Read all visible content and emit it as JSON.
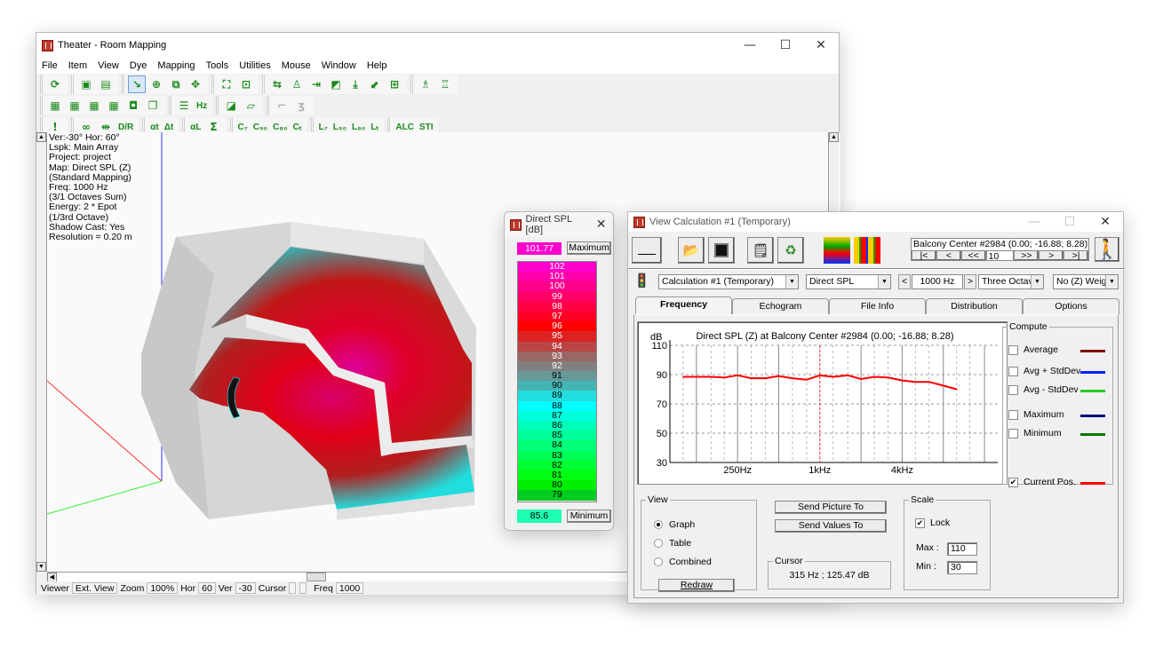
{
  "main_window": {
    "title": "Theater - Room Mapping",
    "controls": {
      "minimize": "—",
      "maximize": "☐",
      "close": "✕"
    },
    "menu": [
      "File",
      "Item",
      "View",
      "Dye",
      "Mapping",
      "Tools",
      "Utilities",
      "Mouse",
      "Window",
      "Help"
    ],
    "toolbar_row1": [
      {
        "icon": "refresh-icon",
        "glyph": "⟳"
      },
      {
        "icon": "view-export-icon",
        "glyph": "▣"
      },
      {
        "icon": "view-import-icon",
        "glyph": "▤"
      },
      {
        "icon": "pointer-tool-icon",
        "glyph": "↘"
      },
      {
        "icon": "target-icon",
        "glyph": "⊕"
      },
      {
        "icon": "zoom-window-icon",
        "glyph": "⧉"
      },
      {
        "icon": "pan-icon",
        "glyph": "✥"
      },
      {
        "icon": "zoom-extents-icon",
        "glyph": "⛶"
      },
      {
        "icon": "fit-all-icon",
        "glyph": "⊡"
      },
      {
        "icon": "rotate-object-icon",
        "glyph": "⇆"
      },
      {
        "icon": "listener-icon",
        "glyph": "♙"
      },
      {
        "icon": "move-to-icon",
        "glyph": "⇥"
      },
      {
        "icon": "select-area-icon",
        "glyph": "◩"
      },
      {
        "icon": "download-icon",
        "glyph": "⤓"
      },
      {
        "icon": "arrow-diagonal-icon",
        "glyph": "⬋"
      },
      {
        "icon": "frame-icon",
        "glyph": "⊞"
      },
      {
        "icon": "loudspeaker-add-icon",
        "glyph": "♗"
      },
      {
        "icon": "loudspeaker-remove-icon",
        "glyph": "♖"
      }
    ],
    "toolbar_row2": [
      {
        "icon": "layout-1-icon",
        "glyph": "▦"
      },
      {
        "icon": "layout-2-icon",
        "glyph": "▦"
      },
      {
        "icon": "layout-3-icon",
        "glyph": "▦"
      },
      {
        "icon": "layout-4-icon",
        "glyph": "▦"
      },
      {
        "icon": "layout-5-icon",
        "glyph": "◘"
      },
      {
        "icon": "layers-icon",
        "glyph": "❐"
      },
      {
        "icon": "list-icon",
        "glyph": "☰"
      },
      {
        "icon": "hz-icon",
        "glyph": "Hz"
      },
      {
        "icon": "face-icon",
        "glyph": "◪"
      },
      {
        "icon": "surface-icon",
        "glyph": "▱"
      },
      {
        "icon": "microphone-icon",
        "glyph": "⌐",
        "disabled": true
      },
      {
        "icon": "ear-icon",
        "glyph": "ʒ",
        "disabled": true
      }
    ],
    "toolbar_row3": [
      {
        "icon": "exclamation-icon",
        "glyph": "!"
      },
      {
        "icon": "link-icon",
        "glyph": "∞"
      },
      {
        "icon": "distance-icon",
        "glyph": "⇹"
      },
      {
        "icon": "dr-ratio-icon",
        "glyph": "D/R"
      },
      {
        "icon": "delay-icon",
        "glyph": "αt"
      },
      {
        "icon": "delta-t-icon",
        "glyph": "Δt"
      },
      {
        "icon": "alpha-l-icon",
        "glyph": "αL"
      },
      {
        "icon": "sum-icon",
        "glyph": "Σ"
      },
      {
        "icon": "c7-icon",
        "glyph": "C₇"
      },
      {
        "icon": "c50-icon",
        "glyph": "C₅₀"
      },
      {
        "icon": "c80-icon",
        "glyph": "C₈₀"
      },
      {
        "icon": "ct-icon",
        "glyph": "Cₜ"
      },
      {
        "icon": "l7-icon",
        "glyph": "L₇"
      },
      {
        "icon": "l50-icon",
        "glyph": "L₅₀"
      },
      {
        "icon": "l80-icon",
        "glyph": "L₈₀"
      },
      {
        "icon": "lt-icon",
        "glyph": "Lₜ"
      },
      {
        "icon": "alc-icon",
        "glyph": "ALC"
      },
      {
        "icon": "sti-icon",
        "glyph": "STI"
      }
    ],
    "info_lines": [
      "Ver:-30°   Hor: 60°",
      "Lspk: Main Array",
      "Project: project",
      "Map: Direct SPL (Z)",
      "(Standard Mapping)",
      "Freq: 1000 Hz",
      "(3/1 Octaves Sum)",
      "Energy: 2 * Epot",
      "(1/3rd Octave)",
      "Shadow Cast: Yes",
      "Resolution =   0.20 m"
    ],
    "statusbar": {
      "viewer_label": "Viewer",
      "viewer_value": "Ext. View",
      "zoom_label": "Zoom",
      "zoom_value": "100%",
      "hor_label": "Hor",
      "hor_value": "60",
      "ver_label": "Ver",
      "ver_value": "-30",
      "cursor_label": "Cursor",
      "cursor_value": "",
      "freq_label": "Freq",
      "freq_value": "1000"
    }
  },
  "legend_window": {
    "title": "Direct SPL [dB]",
    "close": "✕",
    "max_value": "101.77",
    "max_button": "Maximum",
    "min_value": "85.6",
    "min_button": "Minimum",
    "scale": [
      {
        "v": "102",
        "c": "#ff00cc",
        "t": "#ffffff"
      },
      {
        "v": "101",
        "c": "#ff00aa",
        "t": "#ffffff"
      },
      {
        "v": "100",
        "c": "#ff0088",
        "t": "#ffffff"
      },
      {
        "v": "99",
        "c": "#ff0066",
        "t": "#ffffff"
      },
      {
        "v": "98",
        "c": "#ff0044",
        "t": "#ffffff"
      },
      {
        "v": "97",
        "c": "#ff0022",
        "t": "#ffffff"
      },
      {
        "v": "96",
        "c": "#ff0000",
        "t": "#ffffff"
      },
      {
        "v": "95",
        "c": "#dd2222",
        "t": "#ffffff"
      },
      {
        "v": "94",
        "c": "#bb4444",
        "t": "#ffffff"
      },
      {
        "v": "93",
        "c": "#9a6666",
        "t": "#ffffff"
      },
      {
        "v": "92",
        "c": "#808080",
        "t": "#ffffff"
      },
      {
        "v": "91",
        "c": "#669999",
        "t": "#000000"
      },
      {
        "v": "90",
        "c": "#44b4b4",
        "t": "#000000"
      },
      {
        "v": "89",
        "c": "#22dddd",
        "t": "#000000"
      },
      {
        "v": "88",
        "c": "#00ffff",
        "t": "#000000"
      },
      {
        "v": "87",
        "c": "#00ffdd",
        "t": "#000000"
      },
      {
        "v": "86",
        "c": "#00ffbb",
        "t": "#000000"
      },
      {
        "v": "85",
        "c": "#00ff99",
        "t": "#000000"
      },
      {
        "v": "84",
        "c": "#00ff77",
        "t": "#000000"
      },
      {
        "v": "83",
        "c": "#00ff55",
        "t": "#000000"
      },
      {
        "v": "82",
        "c": "#00ff33",
        "t": "#000000"
      },
      {
        "v": "81",
        "c": "#00ff11",
        "t": "#000000"
      },
      {
        "v": "80",
        "c": "#00ee00",
        "t": "#000000"
      },
      {
        "v": "79",
        "c": "#00cc22",
        "t": "#000000"
      }
    ]
  },
  "calc_window": {
    "title": "View Calculation #1 (Temporary)",
    "controls": {
      "minimize": "—",
      "maximize": "☐",
      "close": "✕"
    },
    "location_text": "Balcony Center #2984  (0.00; -16.88; 8.28)",
    "nav": {
      "first": "|<",
      "prev": "<",
      "prev10": "<<",
      "step": "10",
      "next10": ">>",
      "next": ">",
      "last": ">|"
    },
    "calc_select": "Calculation #1 (Temporary)",
    "type_select": "Direct SPL",
    "freq_prev": "<",
    "freq_value": "1000 Hz",
    "freq_next": ">",
    "band_select": "Three Octave",
    "weight_select": "No (Z) Weigh",
    "tabs": [
      "Frequency",
      "Echogram",
      "File Info",
      "Distribution",
      "Options"
    ],
    "active_tab": "Frequency",
    "compute": {
      "legend": "Compute",
      "items": [
        {
          "label": "Average",
          "checked": false,
          "color": "#800000"
        },
        {
          "label": "Avg + StdDev",
          "checked": false,
          "color": "#0022ff"
        },
        {
          "label": "Avg - StdDev",
          "checked": false,
          "color": "#22cc22"
        },
        {
          "label": "Maximum",
          "checked": false,
          "color": "#000080"
        },
        {
          "label": "Minimum",
          "checked": false,
          "color": "#007700"
        },
        {
          "label": "Current Pos.",
          "checked": true,
          "color": "#ff0000"
        }
      ]
    },
    "view_group": {
      "legend": "View",
      "options": [
        {
          "label": "Graph",
          "selected": true
        },
        {
          "label": "Table",
          "selected": false
        },
        {
          "label": "Combined",
          "selected": false
        }
      ],
      "redraw": "Redraw"
    },
    "send_picture": "Send Picture To",
    "send_values": "Send Values To",
    "cursor": {
      "legend": "Cursor",
      "value": "315 Hz ; 125.47 dB"
    },
    "scale": {
      "legend": "Scale",
      "lock_label": "Lock",
      "lock": true,
      "max_label": "Max :",
      "max": "110",
      "min_label": "Min :",
      "min": "30"
    }
  },
  "chart_data": {
    "type": "line",
    "title": "Direct SPL (Z) at Balcony Center #2984  (0.00; -16.88; 8.28)",
    "ylabel": "dB",
    "xlabel": "",
    "x_scale": "log",
    "ylim": [
      30,
      110
    ],
    "yticks": [
      30,
      50,
      70,
      90,
      110
    ],
    "xtick_labels": [
      {
        "hz": 250,
        "label": "250Hz"
      },
      {
        "hz": 1000,
        "label": "1kHz"
      },
      {
        "hz": 4000,
        "label": "4kHz"
      }
    ],
    "xlim_hz": [
      80,
      20000
    ],
    "cursor_hz": 1000,
    "grid": true,
    "series": [
      {
        "name": "Current Pos.",
        "color": "#ff0000",
        "x": [
          100,
          125,
          160,
          200,
          250,
          315,
          400,
          500,
          630,
          800,
          1000,
          1250,
          1600,
          2000,
          2500,
          3150,
          4000,
          5000,
          6300,
          8000,
          10000
        ],
        "values": [
          88.5,
          88.5,
          88.5,
          88,
          89.5,
          87.5,
          87.5,
          89,
          87.5,
          86.5,
          89.5,
          88.5,
          89.5,
          87,
          88.5,
          88,
          86,
          85,
          85,
          82.5,
          80
        ]
      }
    ]
  }
}
